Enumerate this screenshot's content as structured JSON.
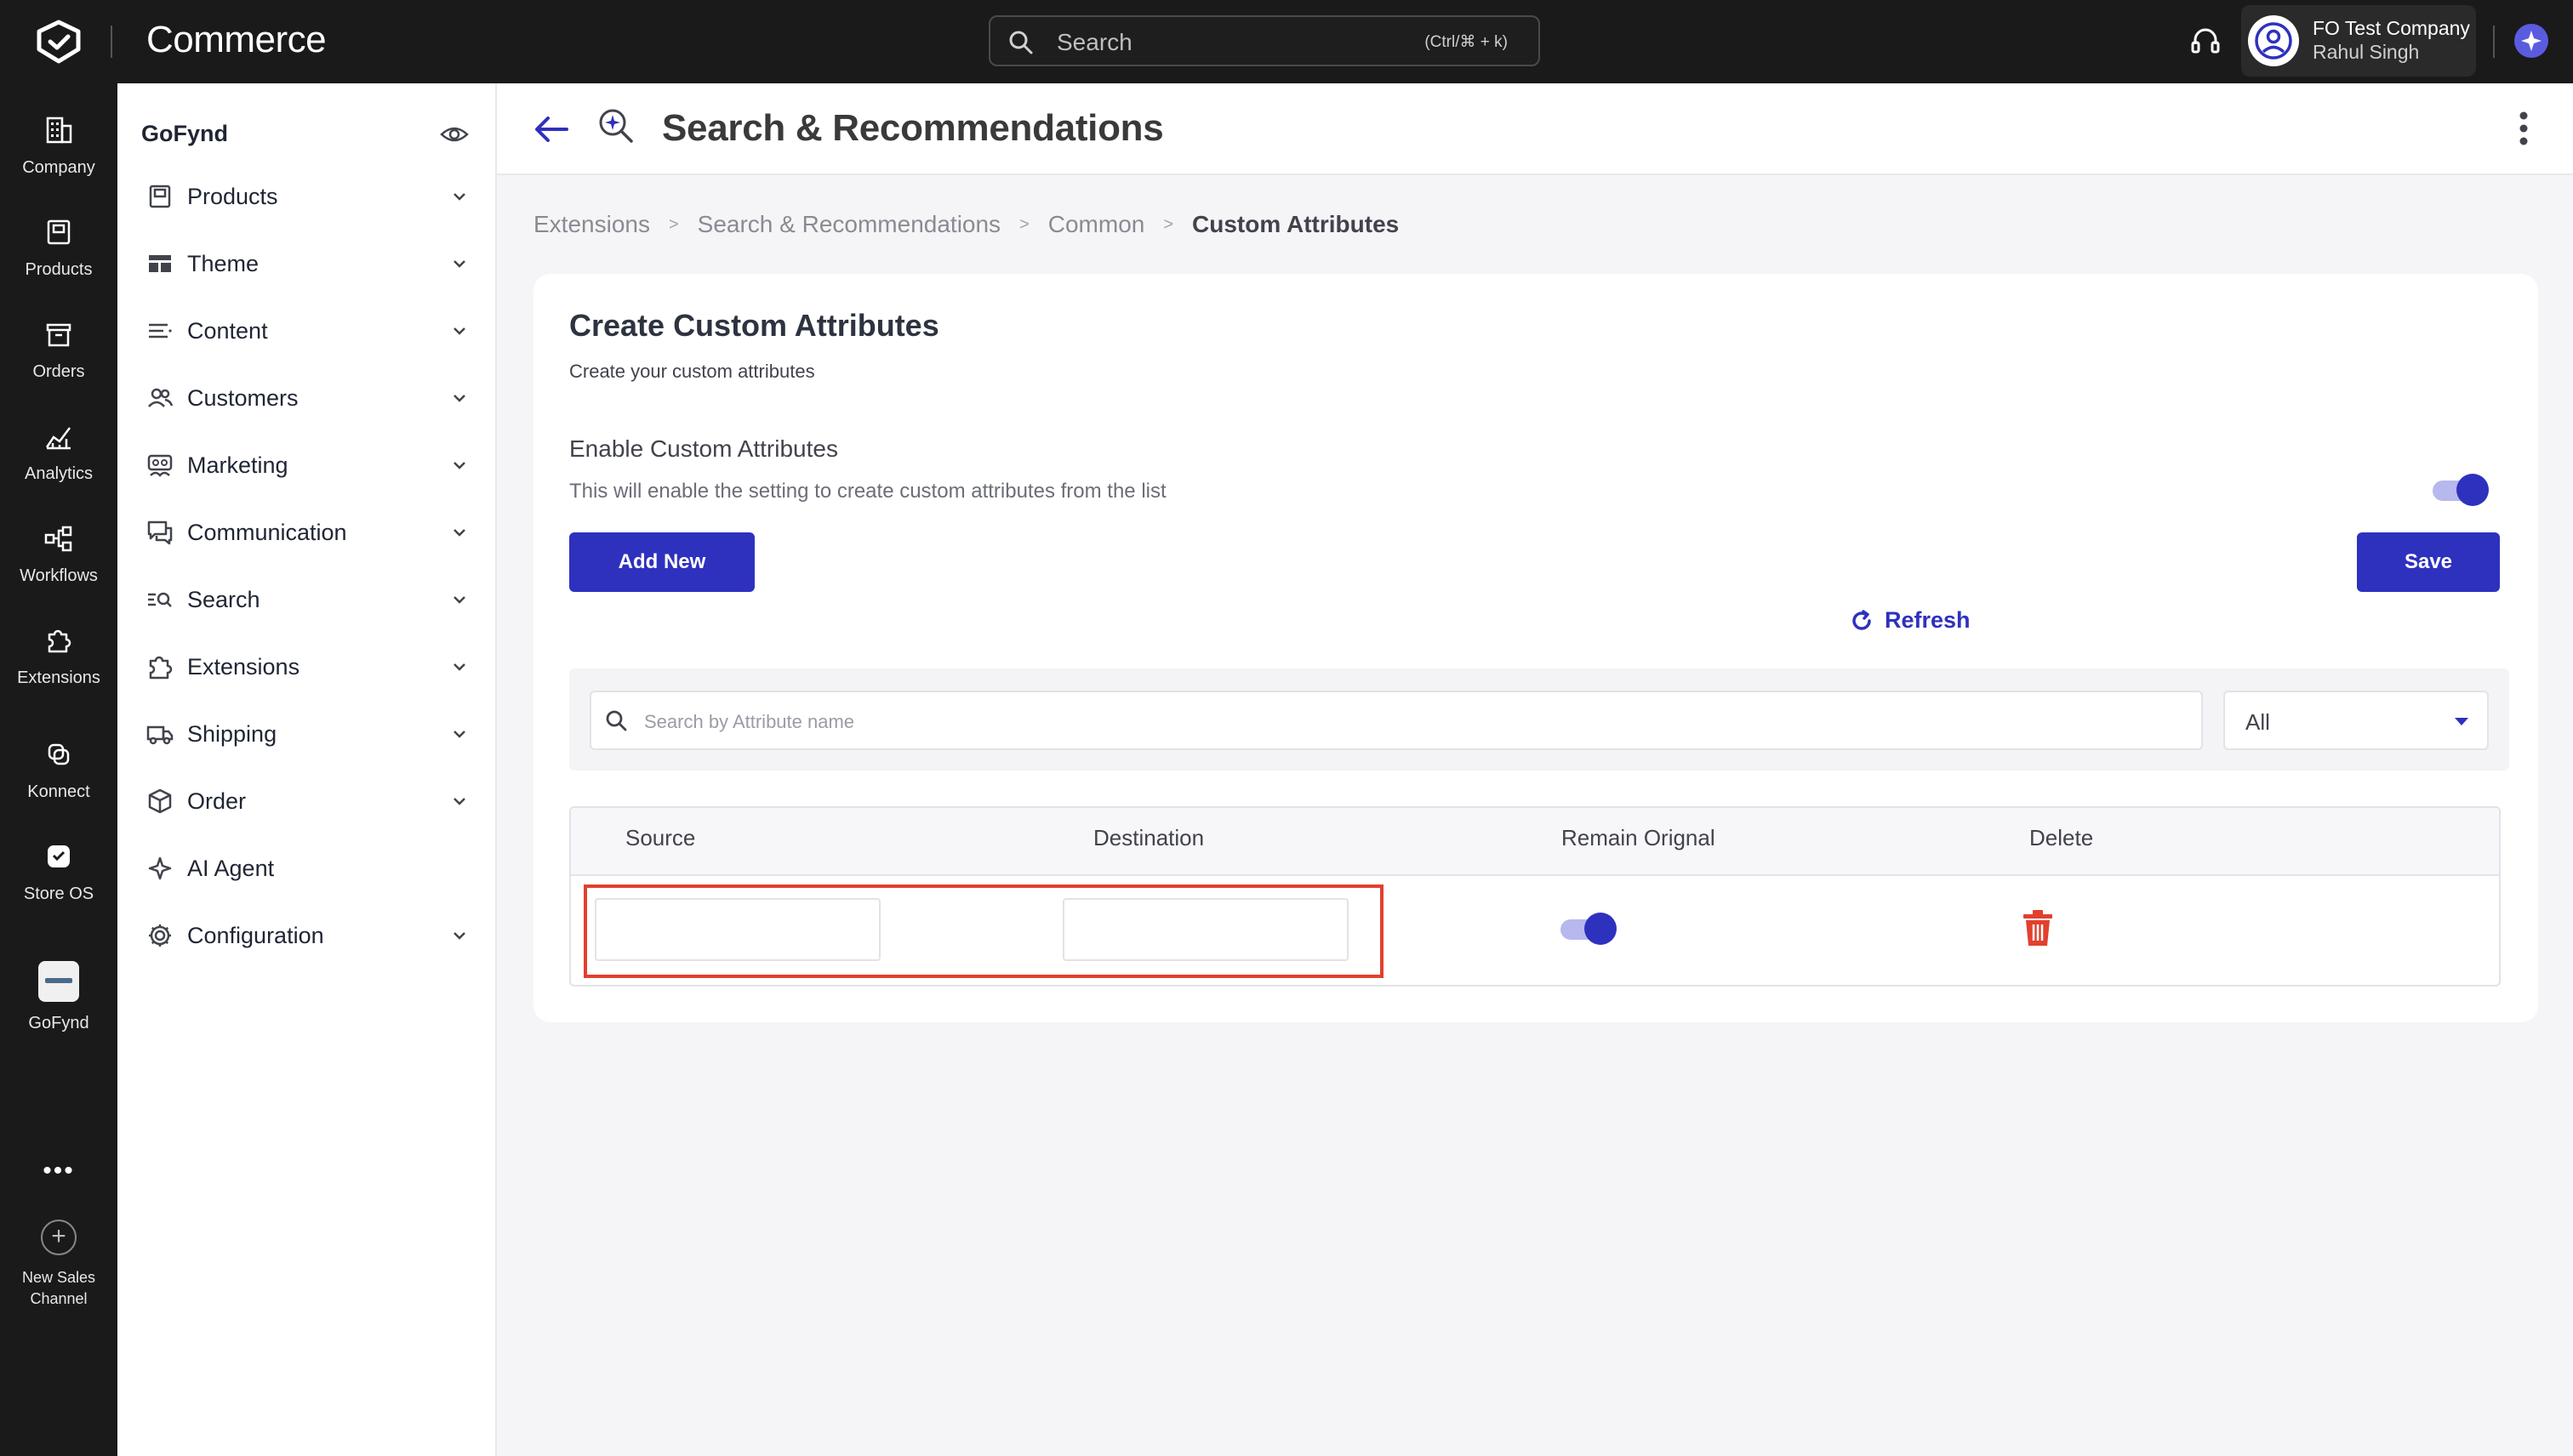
{
  "app": {
    "name": "Commerce"
  },
  "topbar": {
    "search_placeholder": "Search",
    "search_shortcut": "(Ctrl/⌘ + k)",
    "user_company": "FO Test Company",
    "user_name": "Rahul Singh"
  },
  "rail": {
    "items": [
      {
        "label": "Company",
        "icon": "building-icon"
      },
      {
        "label": "Products",
        "icon": "box-icon"
      },
      {
        "label": "Orders",
        "icon": "orders-icon"
      },
      {
        "label": "Analytics",
        "icon": "chart-icon"
      },
      {
        "label": "Workflows",
        "icon": "workflow-icon"
      },
      {
        "label": "Extensions",
        "icon": "puzzle-icon"
      },
      {
        "label": "Konnect",
        "icon": "konnect-icon"
      },
      {
        "label": "Store OS",
        "icon": "store-os-icon"
      },
      {
        "label": "GoFynd",
        "icon": "gofynd-logo"
      }
    ],
    "more": "•••",
    "new_channel_line1": "New Sales",
    "new_channel_line2": "Channel"
  },
  "sidenav": {
    "title": "GoFynd",
    "items": [
      {
        "label": "Products",
        "expandable": true
      },
      {
        "label": "Theme",
        "expandable": true
      },
      {
        "label": "Content",
        "expandable": true
      },
      {
        "label": "Customers",
        "expandable": true
      },
      {
        "label": "Marketing",
        "expandable": true
      },
      {
        "label": "Communication",
        "expandable": true
      },
      {
        "label": "Search",
        "expandable": true
      },
      {
        "label": "Extensions",
        "expandable": true
      },
      {
        "label": "Shipping",
        "expandable": true
      },
      {
        "label": "Order",
        "expandable": true
      },
      {
        "label": "AI Agent",
        "expandable": false
      },
      {
        "label": "Configuration",
        "expandable": true
      }
    ]
  },
  "header": {
    "title": "Search & Recommendations"
  },
  "breadcrumb": {
    "items": [
      "Extensions",
      "Search & Recommendations",
      "Common"
    ],
    "current": "Custom Attributes",
    "separator": ">"
  },
  "card": {
    "title": "Create Custom Attributes",
    "subtitle": "Create your custom attributes",
    "enable_title": "Enable Custom Attributes",
    "enable_description": "This will enable the setting to create custom attributes from the list",
    "enable_on": true,
    "add_new_label": "Add New",
    "save_label": "Save",
    "refresh_label": "Refresh",
    "search_placeholder": "Search by Attribute name",
    "filter_value": "All"
  },
  "table": {
    "columns": [
      "Source",
      "Destination",
      "Remain Orignal",
      "Delete"
    ],
    "rows": [
      {
        "source": "",
        "destination": "",
        "remain_original": true
      }
    ]
  },
  "colors": {
    "primary": "#2e31be",
    "danger": "#e2402f",
    "topbar": "#1a1a1a"
  }
}
